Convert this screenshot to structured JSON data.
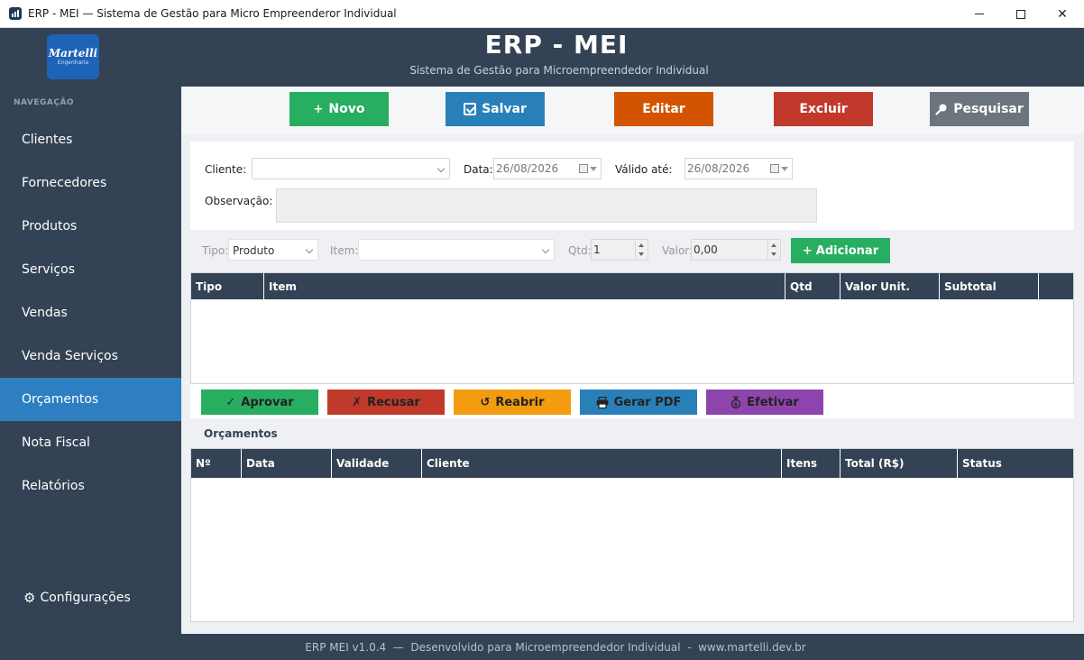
{
  "window": {
    "title": "ERP - MEI — Sistema de Gestão para Micro Empreenderor Individual",
    "minimize_symbol": "—",
    "maximize_symbol": "☐",
    "close_symbol": "✕"
  },
  "header": {
    "logo_text": "Martelli",
    "logo_subtext": "Engenharia",
    "title": "ERP - MEI",
    "subtitle": "Sistema de Gestão para Microempreendedor Individual"
  },
  "sidebar": {
    "section_title": "NAVEGAÇÃO",
    "items": [
      {
        "label": "Clientes"
      },
      {
        "label": "Fornecedores"
      },
      {
        "label": "Produtos"
      },
      {
        "label": "Serviços"
      },
      {
        "label": "Vendas"
      },
      {
        "label": "Venda Serviços"
      },
      {
        "label": "Orçamentos",
        "active": true
      },
      {
        "label": "Nota Fiscal"
      },
      {
        "label": "Relatórios"
      }
    ],
    "config_label": "Configurações",
    "config_icon": "gear-icon",
    "active_color": "#2d7fc2",
    "bg_color": "#334254"
  },
  "toolbar": {
    "novo": {
      "label": "Novo",
      "icon": "+",
      "color": "#27ae60"
    },
    "salvar": {
      "label": "Salvar",
      "icon": "check-square-icon",
      "color": "#2980b9"
    },
    "editar": {
      "label": "Editar",
      "color": "#d35400"
    },
    "excluir": {
      "label": "Excluir",
      "color": "#c0392b"
    },
    "pesquisar": {
      "label": "Pesquisar",
      "icon": "search-icon",
      "color": "#6c757d"
    }
  },
  "form": {
    "cliente_label": "Cliente:",
    "cliente_value": "",
    "data_label": "Data:",
    "data_value": "26/08/2026",
    "valido_label": "Válido até:",
    "valido_value": "26/08/2026",
    "observacao_label": "Observação:",
    "observacao_value": ""
  },
  "item_entry": {
    "tipo_label": "Tipo:",
    "tipo_value": "Produto",
    "item_label": "Item:",
    "item_value": "",
    "qtd_label": "Qtd:",
    "qtd_value": "1",
    "valor_label": "Valor:",
    "valor_value": "0,00",
    "add_label": "Adicionar",
    "add_icon": "+"
  },
  "items_table": {
    "columns": [
      "Tipo",
      "Item",
      "Qtd",
      "Valor Unit.",
      "Subtotal"
    ],
    "rows": []
  },
  "actions": {
    "aprovar": {
      "label": "Aprovar",
      "icon": "✓",
      "color": "#27ae60"
    },
    "recusar": {
      "label": "Recusar",
      "icon": "✗",
      "color": "#c0392b"
    },
    "reabrir": {
      "label": "Reabrir",
      "icon": "↺",
      "color": "#f39c12"
    },
    "gerar_pdf": {
      "label": "Gerar PDF",
      "icon": "printer-icon",
      "color": "#2980b9"
    },
    "efetivar": {
      "label": "Efetivar",
      "icon": "money-bag-icon",
      "color": "#8e44ad"
    }
  },
  "orcamentos": {
    "title": "Orçamentos",
    "columns": [
      "Nº",
      "Data",
      "Validade",
      "Cliente",
      "Itens",
      "Total (R$)",
      "Status"
    ],
    "rows": []
  },
  "footer": {
    "text": "ERP MEI v1.0.4  —  Desenvolvido para Microempreendedor Individual  -  www.martelli.dev.br"
  }
}
